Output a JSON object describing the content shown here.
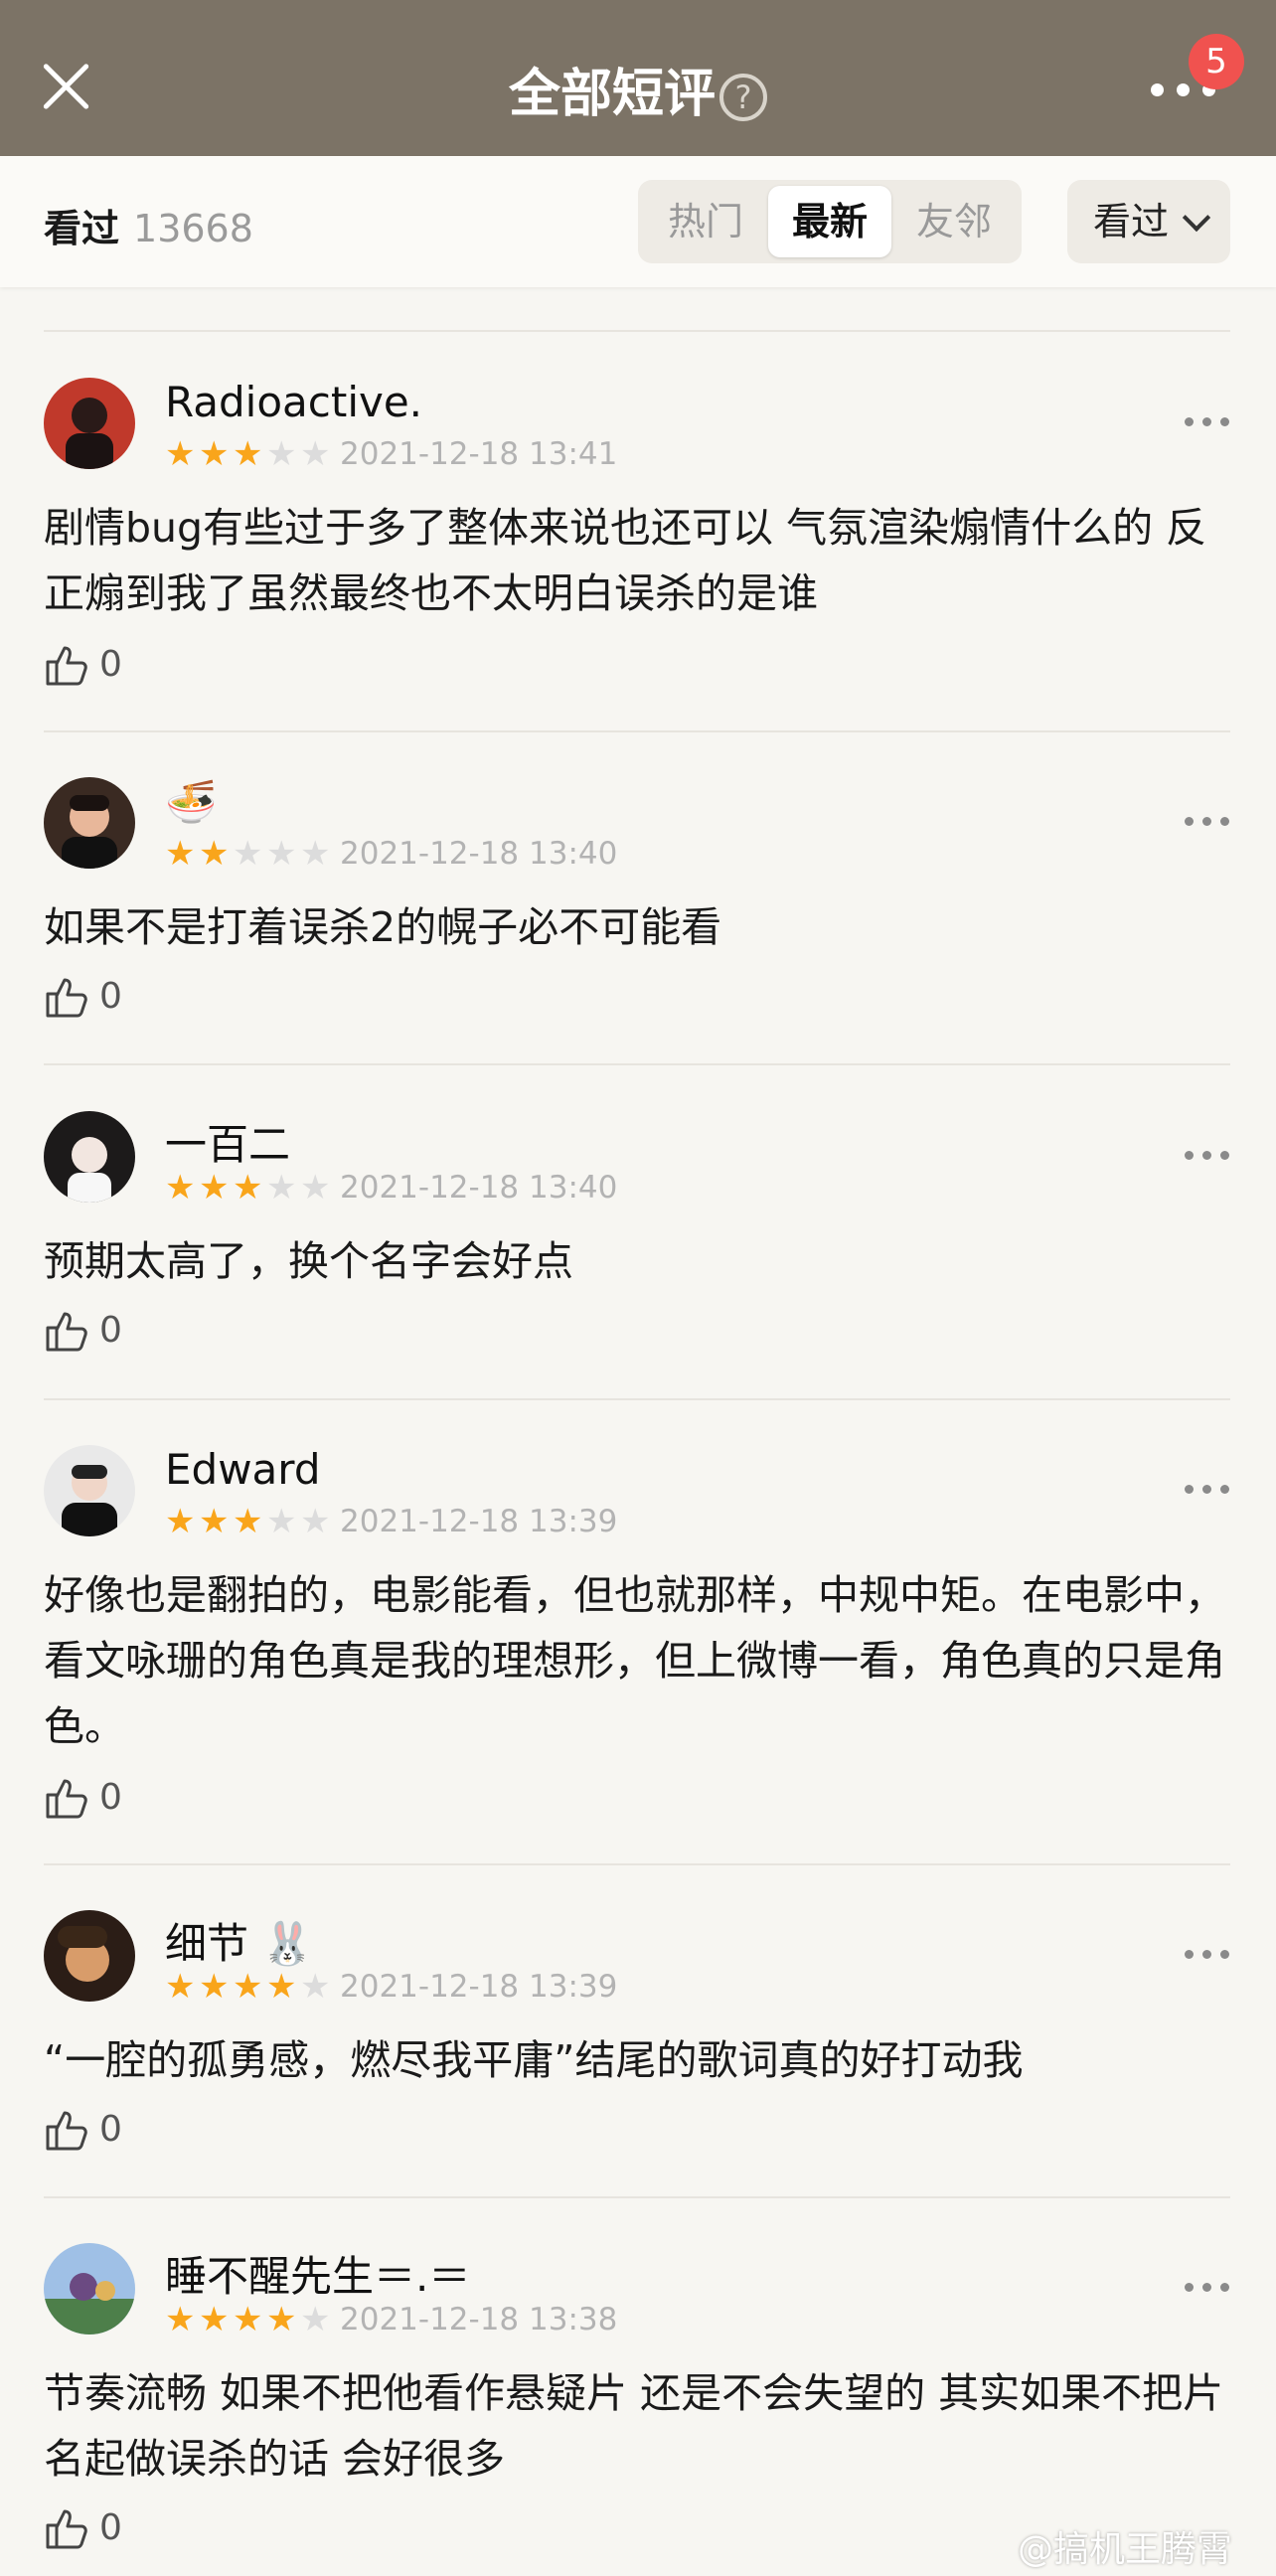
{
  "header": {
    "close_label": "",
    "title": "全部短评",
    "help_glyph": "?",
    "notification_count": "5"
  },
  "filter_bar": {
    "seen_label": "看过",
    "seen_count": "13668",
    "tabs": [
      {
        "label": "热门"
      },
      {
        "label": "最新"
      },
      {
        "label": "友邻"
      }
    ],
    "active_tab": "最新",
    "dropdown_label": "看过"
  },
  "comments": [
    {
      "name": "Radioactive.",
      "stars": 3,
      "date": "2021-12-18 13:41",
      "text": "剧情bug有些过于多了整体来说也还可以 气氛渲染煽情什么的 反正煽到我了虽然最终也不太明白误杀的是谁",
      "likes": "0"
    },
    {
      "name": "🍜",
      "stars": 2,
      "date": "2021-12-18 13:40",
      "text": "如果不是打着误杀2的幌子必不可能看",
      "likes": "0"
    },
    {
      "name": "一百二",
      "stars": 3,
      "date": "2021-12-18 13:40",
      "text": "预期太高了，换个名字会好点",
      "likes": "0"
    },
    {
      "name": "Edward",
      "stars": 3,
      "date": "2021-12-18 13:39",
      "text": "好像也是翻拍的，电影能看，但也就那样，中规中矩。在电影中，看文咏珊的角色真是我的理想形，但上微博一看，角色真的只是角色。",
      "likes": "0"
    },
    {
      "name": "细节 🐰",
      "stars": 4,
      "date": "2021-12-18 13:39",
      "text": "“一腔的孤勇感，燃尽我平庸”结尾的歌词真的好打动我",
      "likes": "0"
    },
    {
      "name": "睡不醒先生＝.＝",
      "stars": 4,
      "date": "2021-12-18 13:38",
      "text": "节奏流畅 如果不把他看作悬疑片 还是不会失望的 其实如果不把片名起做误杀的话 会好很多",
      "likes": "0"
    }
  ],
  "colors": {
    "header_bg": "#7c7366",
    "star_on": "#f9a51b",
    "star_off": "#dcdcdc",
    "badge": "#f0524f"
  },
  "watermark": "@搞机王腾霄"
}
